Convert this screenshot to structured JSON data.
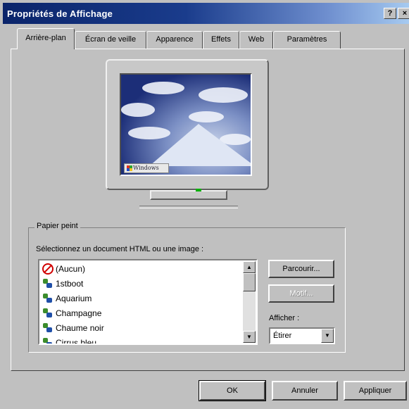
{
  "window": {
    "title": "Propriétés de Affichage",
    "help_label": "?",
    "close_label": "×"
  },
  "tabs": [
    {
      "label": "Arrière-plan",
      "active": true
    },
    {
      "label": "Écran de veille",
      "active": false
    },
    {
      "label": "Apparence",
      "active": false
    },
    {
      "label": "Effets",
      "active": false
    },
    {
      "label": "Web",
      "active": false
    },
    {
      "label": "Paramètres",
      "active": false
    }
  ],
  "preview": {
    "logo_text": "Windows"
  },
  "wallpaper": {
    "group_label": "Papier peint",
    "select_prompt": "Sélectionnez un document HTML ou une image :",
    "items": [
      {
        "label": "(Aucun)",
        "icon": "none-icon"
      },
      {
        "label": "1stboot",
        "icon": "bitmap-icon"
      },
      {
        "label": "Aquarium",
        "icon": "bitmap-icon"
      },
      {
        "label": "Champagne",
        "icon": "bitmap-icon"
      },
      {
        "label": "Chaume noir",
        "icon": "bitmap-icon"
      },
      {
        "label": "Cirrus bleu",
        "icon": "bitmap-icon"
      }
    ],
    "browse_label": "Parcourir...",
    "pattern_label": "Motif...",
    "display_label": "Afficher :",
    "display_value": "Étirer"
  },
  "buttons": {
    "ok": "OK",
    "cancel": "Annuler",
    "apply": "Appliquer"
  }
}
